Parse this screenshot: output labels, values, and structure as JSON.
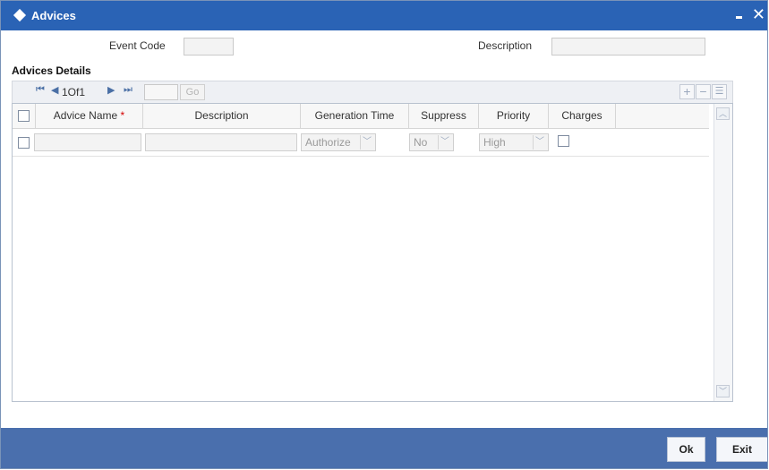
{
  "window": {
    "title": "Advices"
  },
  "header": {
    "event_code_label": "Event Code",
    "event_code_value": "",
    "description_label": "Description",
    "description_value": ""
  },
  "section": {
    "title": "Advices Details"
  },
  "nav": {
    "page_info": "1Of1",
    "page_input": "",
    "go_label": "Go"
  },
  "table": {
    "columns": [
      "Advice Name",
      "Description",
      "Generation Time",
      "Suppress",
      "Priority",
      "Charges"
    ],
    "required_marker": "*",
    "rows": [
      {
        "advice_name": "",
        "description": "",
        "generation_time": "Authorize",
        "suppress": "No",
        "priority": "High",
        "charges": false
      }
    ]
  },
  "footer": {
    "ok_label": "Ok",
    "exit_label": "Exit"
  },
  "colors": {
    "titlebar": "#2a63b5",
    "footer": "#4a6fad",
    "required": "#d40000"
  }
}
